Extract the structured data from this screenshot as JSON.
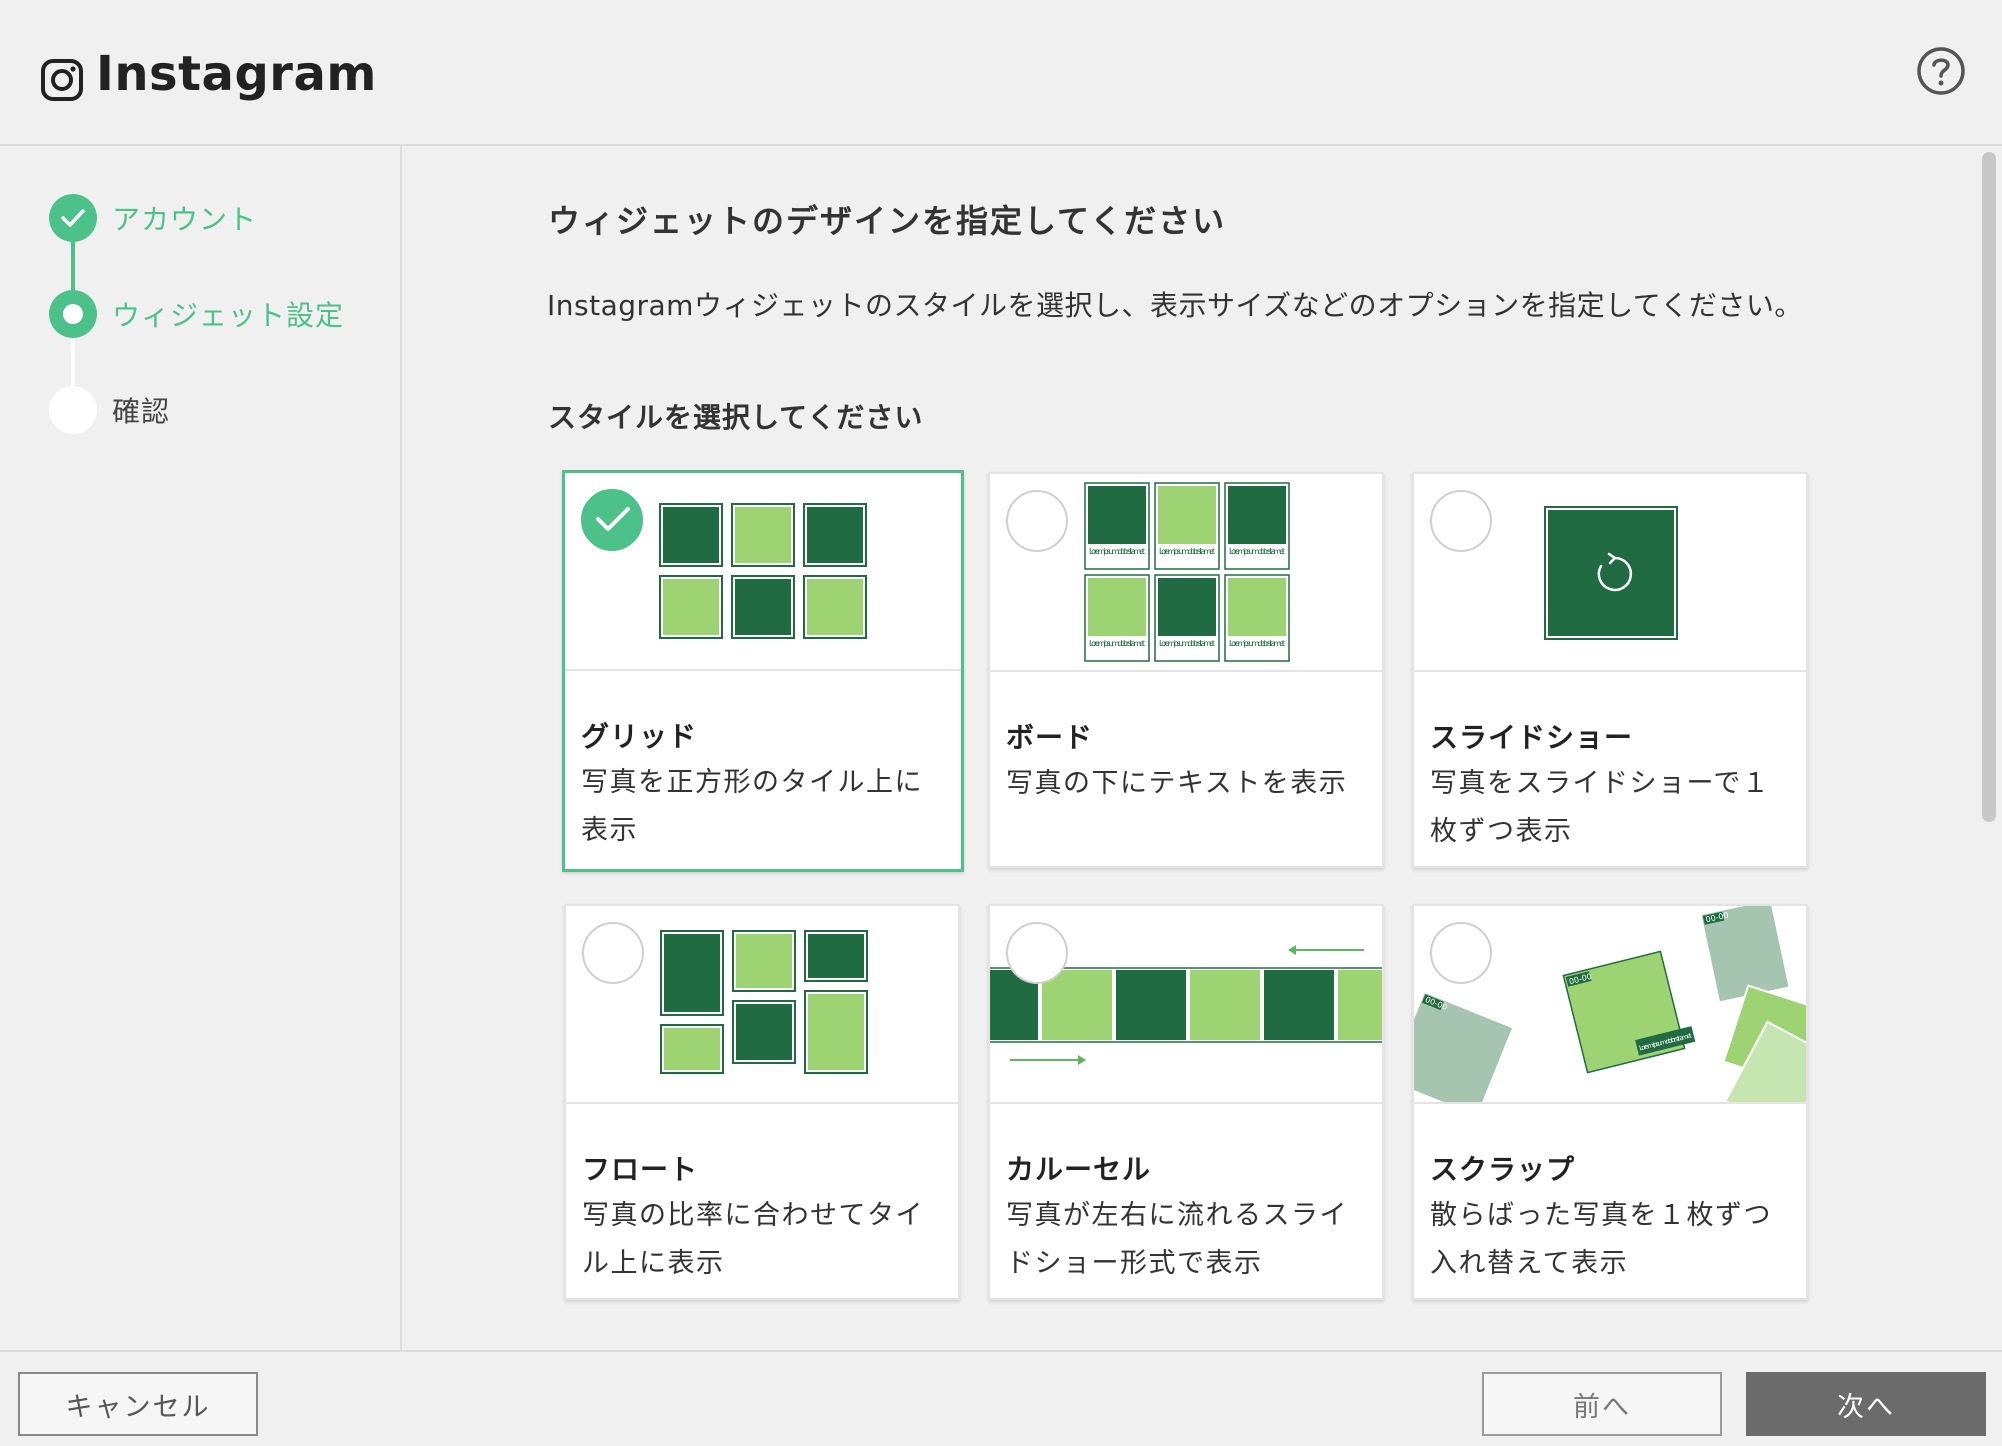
{
  "app": {
    "title": "Instagram"
  },
  "header": {
    "help_icon": "question-circle-icon"
  },
  "steps": [
    {
      "label": "アカウント",
      "state": "done"
    },
    {
      "label": "ウィジェット設定",
      "state": "current"
    },
    {
      "label": "確認",
      "state": "todo"
    }
  ],
  "main": {
    "heading": "ウィジェットのデザインを指定してください",
    "description": "Instagramウィジェットのスタイルを選択し、表示サイズなどのオプションを指定してください。",
    "style_heading": "スタイルを選択してください"
  },
  "styles": [
    {
      "name": "グリッド",
      "desc": "写真を正方形のタイル上に表示",
      "selected": true
    },
    {
      "name": "ボード",
      "desc": "写真の下にテキストを表示",
      "selected": false
    },
    {
      "name": "スライドショー",
      "desc": "写真をスライドショーで１枚ずつ表示",
      "selected": false
    },
    {
      "name": "フロート",
      "desc": "写真の比率に合わせてタイル上に表示",
      "selected": false
    },
    {
      "name": "カルーセル",
      "desc": "写真が左右に流れるスライドショー形式で表示",
      "selected": false
    },
    {
      "name": "スクラップ",
      "desc": "散らばった写真を１枚ずつ入れ替えて表示",
      "selected": false
    }
  ],
  "thumb_text": {
    "lorem": "Lorem ipsum dolor sit amet",
    "lorem_short": "Lorem ipsum dolor sit amet",
    "date": "00-00"
  },
  "footer": {
    "cancel": "キャンセル",
    "prev": "前へ",
    "next": "次へ"
  },
  "colors": {
    "accent": "#4cc18a",
    "tile_dark": "#206b41",
    "tile_light": "#9dd372",
    "button_primary": "#6b6b6b"
  }
}
